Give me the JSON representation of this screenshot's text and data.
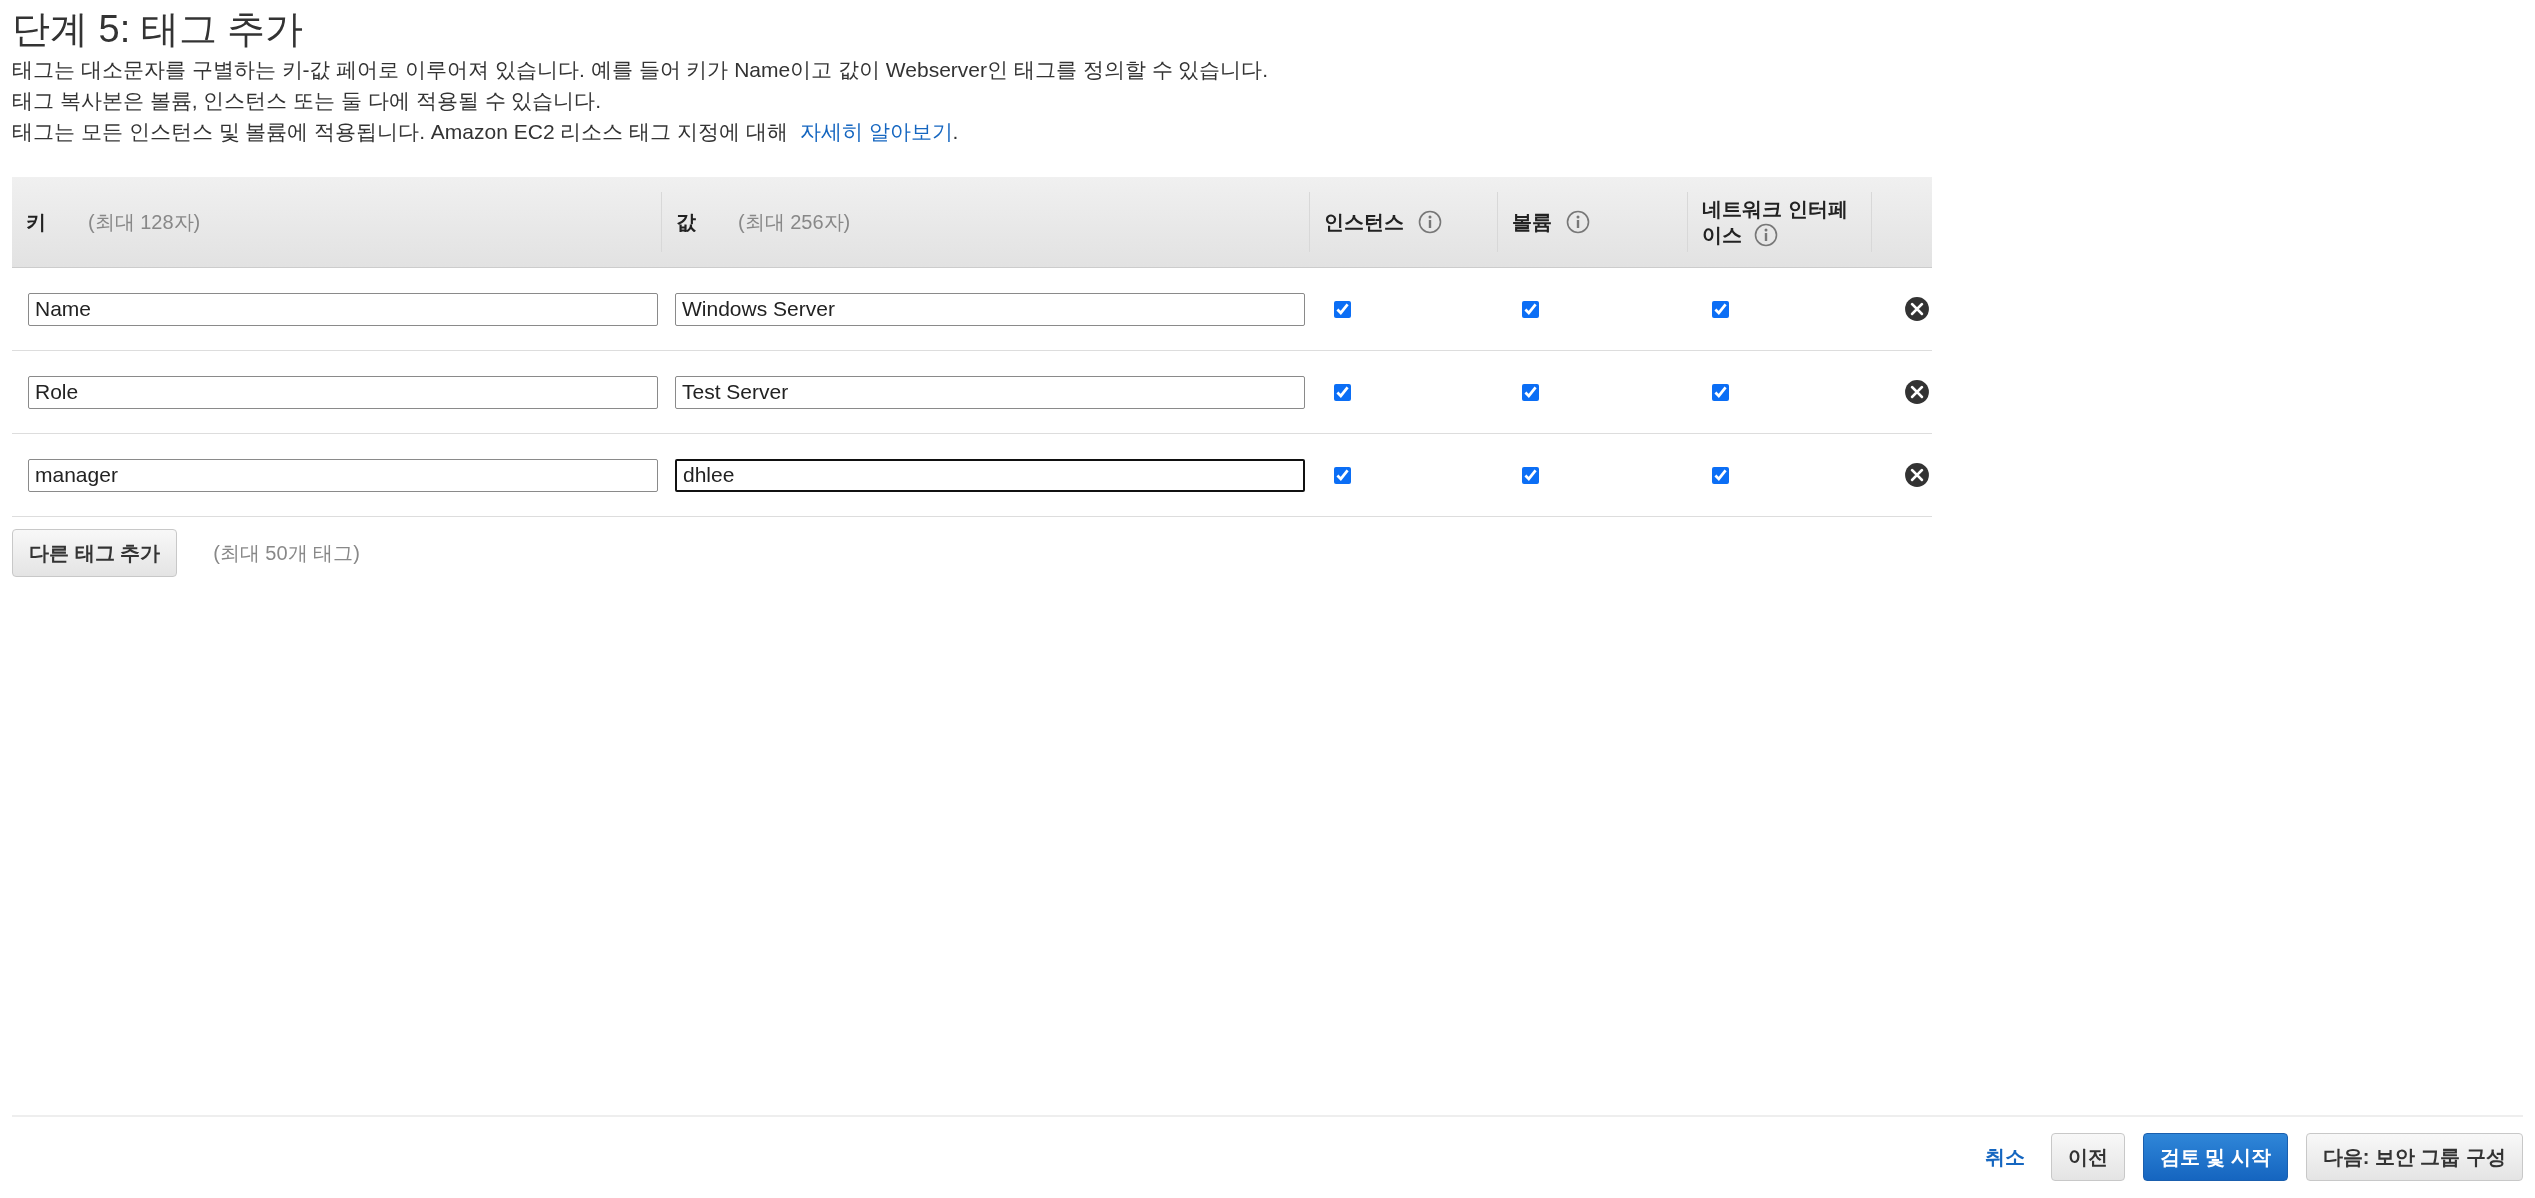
{
  "title": "단계 5: 태그 추가",
  "description": [
    "태그는 대소문자를 구별하는 키-값 페어로 이루어져 있습니다. 예를 들어 키가 Name이고 값이 Webserver인 태그를 정의할 수 있습니다.",
    "태그 복사본은 볼륨, 인스턴스 또는 둘 다에 적용될 수 있습니다.",
    {
      "text": "태그는 모든 인스턴스 및 볼륨에 적용됩니다. Amazon EC2 리소스 태그 지정에 대해",
      "link": "자세히 알아보기",
      "after": "."
    }
  ],
  "table": {
    "columns": [
      {
        "label": "키",
        "hint": "(최대 128자)"
      },
      {
        "label": "값",
        "hint": "(최대 256자)"
      },
      {
        "label": "인스턴스",
        "info": true
      },
      {
        "label": "볼륨",
        "info": true
      },
      {
        "label": "네트워크 인터페",
        "label_line2": "이스",
        "info": true
      }
    ],
    "rows": [
      {
        "key": "Name",
        "value": "Windows Server",
        "focused": false,
        "instances": true,
        "volumes": true,
        "network_interfaces": true
      },
      {
        "key": "Role",
        "value": "Test Server",
        "focused": false,
        "instances": true,
        "volumes": true,
        "network_interfaces": true
      },
      {
        "key": "manager",
        "value": "dhlee",
        "focused": true,
        "instances": true,
        "volumes": true,
        "network_interfaces": true
      }
    ]
  },
  "add_tag": {
    "button": "다른 태그 추가",
    "note": "(최대 50개 태그)"
  },
  "footer_buttons": [
    {
      "label": "취소",
      "kind": "link"
    },
    {
      "label": "이전",
      "kind": "default"
    },
    {
      "label": "검토 및 시작",
      "kind": "primary"
    },
    {
      "label": "다음: 보안 그룹 구성",
      "kind": "default"
    }
  ]
}
